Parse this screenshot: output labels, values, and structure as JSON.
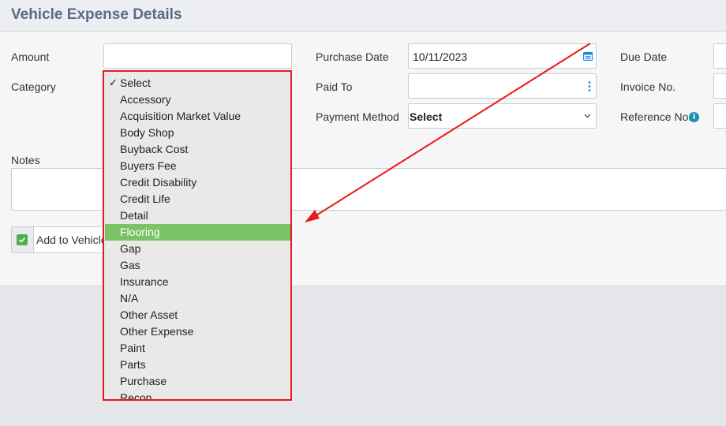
{
  "header": {
    "title": "Vehicle Expense Details"
  },
  "form": {
    "amount_label": "Amount",
    "amount_value": "",
    "category_label": "Category",
    "purchase_date_label": "Purchase Date",
    "purchase_date_value": "10/11/2023",
    "paid_to_label": "Paid To",
    "paid_to_value": "",
    "payment_method_label": "Payment Method",
    "payment_method_value": "Select",
    "due_date_label": "Due Date",
    "invoice_no_label": "Invoice No.",
    "reference_no_label": "Reference No.",
    "notes_label": "Notes",
    "add_to_vehicle_label": "Add to Vehicle",
    "add_to_vehicle_checked": true
  },
  "category_dropdown": {
    "selected": "Select",
    "highlighted": "Flooring",
    "options": [
      "Select",
      "Accessory",
      "Acquisition Market Value",
      "Body Shop",
      "Buyback Cost",
      "Buyers Fee",
      "Credit Disability",
      "Credit Life",
      "Detail",
      "Flooring",
      "Gap",
      "Gas",
      "Insurance",
      "N/A",
      "Other Asset",
      "Other Expense",
      "Paint",
      "Parts",
      "Purchase",
      "Recon"
    ]
  },
  "colors": {
    "highlight": "#7bc266",
    "annotation": "#e8191b",
    "title": "#5a6a8a",
    "accent_blue": "#1e88e5"
  },
  "icons": [
    "calendar-icon",
    "kebab-menu-icon",
    "chevron-down-icon",
    "info-icon",
    "checkbox-checked-icon",
    "checkmark-icon"
  ]
}
